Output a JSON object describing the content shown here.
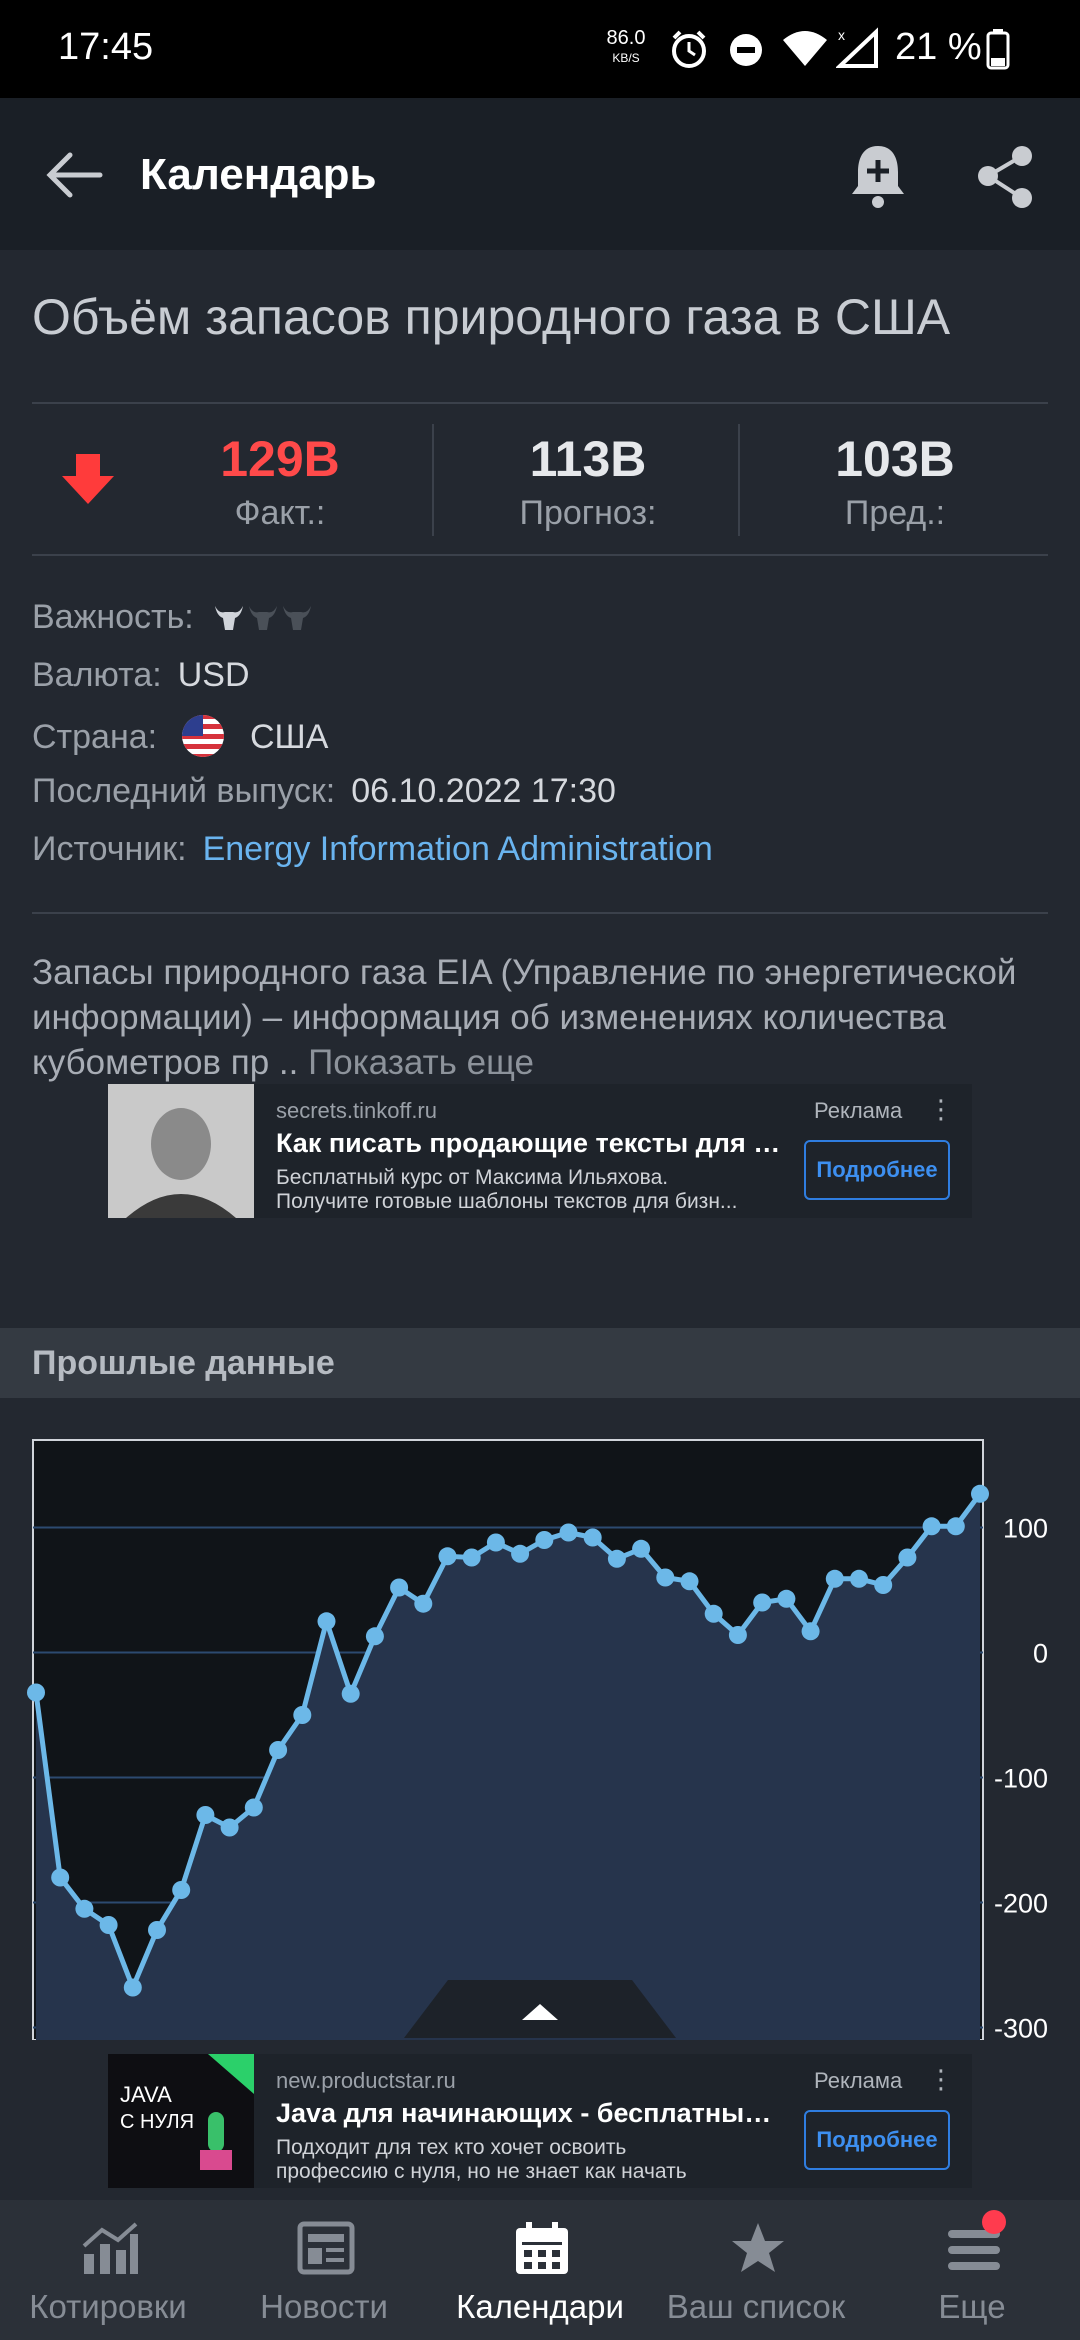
{
  "status_bar": {
    "time": "17:45",
    "net_speed": "86.0",
    "net_speed_unit": "KB/S",
    "battery": "21 %"
  },
  "app_bar": {
    "title": "Календарь"
  },
  "event": {
    "title": "Объём запасов природного газа в США",
    "actual": {
      "value": "129B",
      "label": "Факт.:",
      "color": "#ff4a4a"
    },
    "forecast": {
      "value": "113B",
      "label": "Прогноз:"
    },
    "previous": {
      "value": "103B",
      "label": "Пред.:"
    },
    "direction": "down",
    "importance_label": "Важность:",
    "importance_level": 1,
    "importance_max": 3,
    "currency_label": "Валюта:",
    "currency": "USD",
    "country_label": "Страна:",
    "country": "США",
    "release_label": "Последний выпуск:",
    "release": "06.10.2022 17:30",
    "source_label": "Источник:",
    "source": "Energy Information Administration"
  },
  "description": {
    "text": "Запасы природного газа EIA (Управление по энергетической информации) – информация об изменениях количества кубометров пр ..",
    "more": "Показать еще"
  },
  "ad1": {
    "domain": "secrets.tinkoff.ru",
    "label": "Реклама",
    "headline": "Как писать продающие тексты для б...",
    "body_line1": "Бесплатный курс от Максима Ильяхова.",
    "body_line2": "Получите готовые шаблоны текстов для бизн...",
    "cta": "Подробнее"
  },
  "past_data": {
    "title": "Прошлые данные"
  },
  "chart_data": {
    "type": "area",
    "y_ticks": [
      100,
      0,
      -100,
      -200,
      -300
    ],
    "ylim": [
      -310,
      170
    ],
    "grid": true,
    "legend": "none",
    "values": [
      -32,
      -180,
      -205,
      -218,
      -268,
      -222,
      -190,
      -130,
      -140,
      -124,
      -78,
      -50,
      25,
      -33,
      13,
      52,
      39,
      77,
      76,
      88,
      79,
      90,
      96,
      92,
      75,
      83,
      60,
      57,
      31,
      14,
      40,
      43,
      17,
      59,
      59,
      54,
      76,
      101,
      101,
      127
    ],
    "line_color": "#6cb8e8",
    "fill_color": "#26344c"
  },
  "ad2": {
    "domain": "new.productstar.ru",
    "label": "Реклама",
    "headline": "Java для начинающих - бесплатный ...",
    "body_line1": "Подходит для тех кто хочет освоить",
    "body_line2": "профессию с нуля, но не знает как начать",
    "cta": "Подробнее",
    "thumb_text1": "JAVA",
    "thumb_text2": "С НУЛЯ"
  },
  "bottom_nav": [
    {
      "label": "Котировки",
      "icon": "chart-icon",
      "active": false
    },
    {
      "label": "Новости",
      "icon": "newspaper-icon",
      "active": false
    },
    {
      "label": "Календари",
      "icon": "calendar-icon",
      "active": true
    },
    {
      "label": "Ваш список",
      "icon": "star-icon",
      "active": false
    },
    {
      "label": "Еще",
      "icon": "menu-icon",
      "active": false,
      "badge": true
    }
  ]
}
